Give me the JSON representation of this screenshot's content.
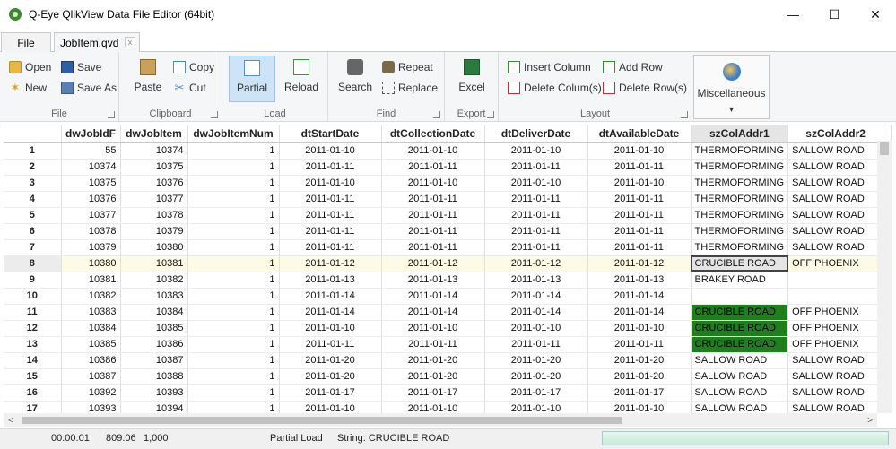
{
  "window": {
    "title": "Q-Eye QlikView Data File Editor (64bit)",
    "minimize_glyph": "—",
    "maximize_glyph": "☐",
    "close_glyph": "✕"
  },
  "tabs": {
    "file": "File",
    "document": "JobItem.qvd",
    "document_close_glyph": "x"
  },
  "ribbon": {
    "file": {
      "label": "File",
      "open": "Open",
      "new": "New",
      "save": "Save",
      "save_as": "Save As"
    },
    "clipboard": {
      "label": "Clipboard",
      "paste": "Paste",
      "copy": "Copy",
      "cut": "Cut"
    },
    "load": {
      "label": "Load",
      "partial": "Partial",
      "reload": "Reload"
    },
    "find": {
      "label": "Find",
      "search": "Search",
      "repeat": "Repeat",
      "replace": "Replace"
    },
    "export": {
      "label": "Export",
      "excel": "Excel"
    },
    "layout": {
      "label": "Layout",
      "insert_column": "Insert Column",
      "delete_columns": "Delete Colum(s)",
      "add_row": "Add Row",
      "delete_rows": "Delete Row(s)"
    },
    "misc": {
      "label": "Miscellaneous",
      "dropdown_glyph": "▾"
    }
  },
  "grid": {
    "columns": [
      "dwJobIdF",
      "dwJobItem",
      "dwJobItemNum",
      "dtStartDate",
      "dtCollectionDate",
      "dtDeliverDate",
      "dtAvailableDate",
      "szColAddr1",
      "szColAddr2"
    ],
    "selected_row": 8,
    "selected_column": "szColAddr1",
    "rows": [
      {
        "n": "1",
        "c": [
          "55",
          "10374",
          "1",
          "2011-01-10",
          "2011-01-10",
          "2011-01-10",
          "2011-01-10",
          "THERMOFORMING",
          "SALLOW ROAD"
        ],
        "green": false
      },
      {
        "n": "2",
        "c": [
          "10374",
          "10375",
          "1",
          "2011-01-11",
          "2011-01-11",
          "2011-01-11",
          "2011-01-11",
          "THERMOFORMING",
          "SALLOW ROAD"
        ],
        "green": false
      },
      {
        "n": "3",
        "c": [
          "10375",
          "10376",
          "1",
          "2011-01-10",
          "2011-01-10",
          "2011-01-10",
          "2011-01-10",
          "THERMOFORMING",
          "SALLOW ROAD"
        ],
        "green": false
      },
      {
        "n": "4",
        "c": [
          "10376",
          "10377",
          "1",
          "2011-01-11",
          "2011-01-11",
          "2011-01-11",
          "2011-01-11",
          "THERMOFORMING",
          "SALLOW ROAD"
        ],
        "green": false
      },
      {
        "n": "5",
        "c": [
          "10377",
          "10378",
          "1",
          "2011-01-11",
          "2011-01-11",
          "2011-01-11",
          "2011-01-11",
          "THERMOFORMING",
          "SALLOW ROAD"
        ],
        "green": false
      },
      {
        "n": "6",
        "c": [
          "10378",
          "10379",
          "1",
          "2011-01-11",
          "2011-01-11",
          "2011-01-11",
          "2011-01-11",
          "THERMOFORMING",
          "SALLOW ROAD"
        ],
        "green": false
      },
      {
        "n": "7",
        "c": [
          "10379",
          "10380",
          "1",
          "2011-01-11",
          "2011-01-11",
          "2011-01-11",
          "2011-01-11",
          "THERMOFORMING",
          "SALLOW ROAD"
        ],
        "green": false
      },
      {
        "n": "8",
        "c": [
          "10380",
          "10381",
          "1",
          "2011-01-12",
          "2011-01-12",
          "2011-01-12",
          "2011-01-12",
          "CRUCIBLE ROAD",
          "OFF PHOENIX"
        ],
        "green": false
      },
      {
        "n": "9",
        "c": [
          "10381",
          "10382",
          "1",
          "2011-01-13",
          "2011-01-13",
          "2011-01-13",
          "2011-01-13",
          "BRAKEY ROAD",
          ""
        ],
        "green": false
      },
      {
        "n": "10",
        "c": [
          "10382",
          "10383",
          "1",
          "2011-01-14",
          "2011-01-14",
          "2011-01-14",
          "2011-01-14",
          "",
          ""
        ],
        "green": false
      },
      {
        "n": "11",
        "c": [
          "10383",
          "10384",
          "1",
          "2011-01-14",
          "2011-01-14",
          "2011-01-14",
          "2011-01-14",
          "CRUCIBLE ROAD",
          "OFF PHOENIX"
        ],
        "green": true
      },
      {
        "n": "12",
        "c": [
          "10384",
          "10385",
          "1",
          "2011-01-10",
          "2011-01-10",
          "2011-01-10",
          "2011-01-10",
          "CRUCIBLE ROAD",
          "OFF PHOENIX"
        ],
        "green": true
      },
      {
        "n": "13",
        "c": [
          "10385",
          "10386",
          "1",
          "2011-01-11",
          "2011-01-11",
          "2011-01-11",
          "2011-01-11",
          "CRUCIBLE ROAD",
          "OFF PHOENIX"
        ],
        "green": true
      },
      {
        "n": "14",
        "c": [
          "10386",
          "10387",
          "1",
          "2011-01-20",
          "2011-01-20",
          "2011-01-20",
          "2011-01-20",
          "SALLOW ROAD",
          "SALLOW ROAD"
        ],
        "green": false
      },
      {
        "n": "15",
        "c": [
          "10387",
          "10388",
          "1",
          "2011-01-20",
          "2011-01-20",
          "2011-01-20",
          "2011-01-20",
          "SALLOW ROAD",
          "SALLOW ROAD"
        ],
        "green": false
      },
      {
        "n": "16",
        "c": [
          "10392",
          "10393",
          "1",
          "2011-01-17",
          "2011-01-17",
          "2011-01-17",
          "2011-01-17",
          "SALLOW ROAD",
          "SALLOW ROAD"
        ],
        "green": false
      },
      {
        "n": "17",
        "c": [
          "10393",
          "10394",
          "1",
          "2011-01-10",
          "2011-01-10",
          "2011-01-10",
          "2011-01-10",
          "SALLOW ROAD",
          "SALLOW ROAD"
        ],
        "green": false
      }
    ]
  },
  "scroll": {
    "left_glyph": "<",
    "right_glyph": ">"
  },
  "status": {
    "elapsed": "00:00:01",
    "value": "809.06",
    "count": "1,000",
    "mode": "Partial Load",
    "string_info": "String: CRUCIBLE ROAD",
    "progress": 1.0
  },
  "colors": {
    "highlight_green": "#1f7f1f",
    "selected_row": "#fdfbe4",
    "ribbon_bg": "#f5f6f7",
    "active_button": "#cde3f7"
  }
}
